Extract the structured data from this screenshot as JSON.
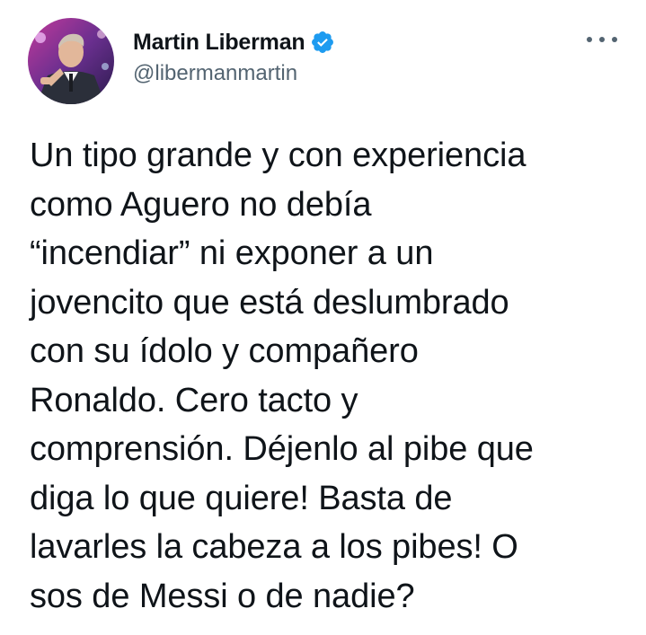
{
  "author": {
    "display_name": "Martin Liberman",
    "handle": "@libermanmartin",
    "verified": true,
    "avatar_icon": "profile-photo"
  },
  "menu": {
    "icon": "more-options-icon"
  },
  "tweet": {
    "text": "Un tipo grande y con experiencia\ncomo Aguero no debía\n“incendiar” ni exponer a un\njovencito que está deslumbrado\ncon su ídolo y compañero\nRonaldo. Cero tacto y\ncomprensión. Déjenlo al pibe que\ndiga lo que quiere! Basta de\nlavarles la cabeza a los pibes! O\nsos de Messi o de nadie?"
  },
  "colors": {
    "text_primary": "#0f1419",
    "text_secondary": "#536471",
    "verified_blue": "#1d9bf0",
    "background": "#ffffff"
  }
}
